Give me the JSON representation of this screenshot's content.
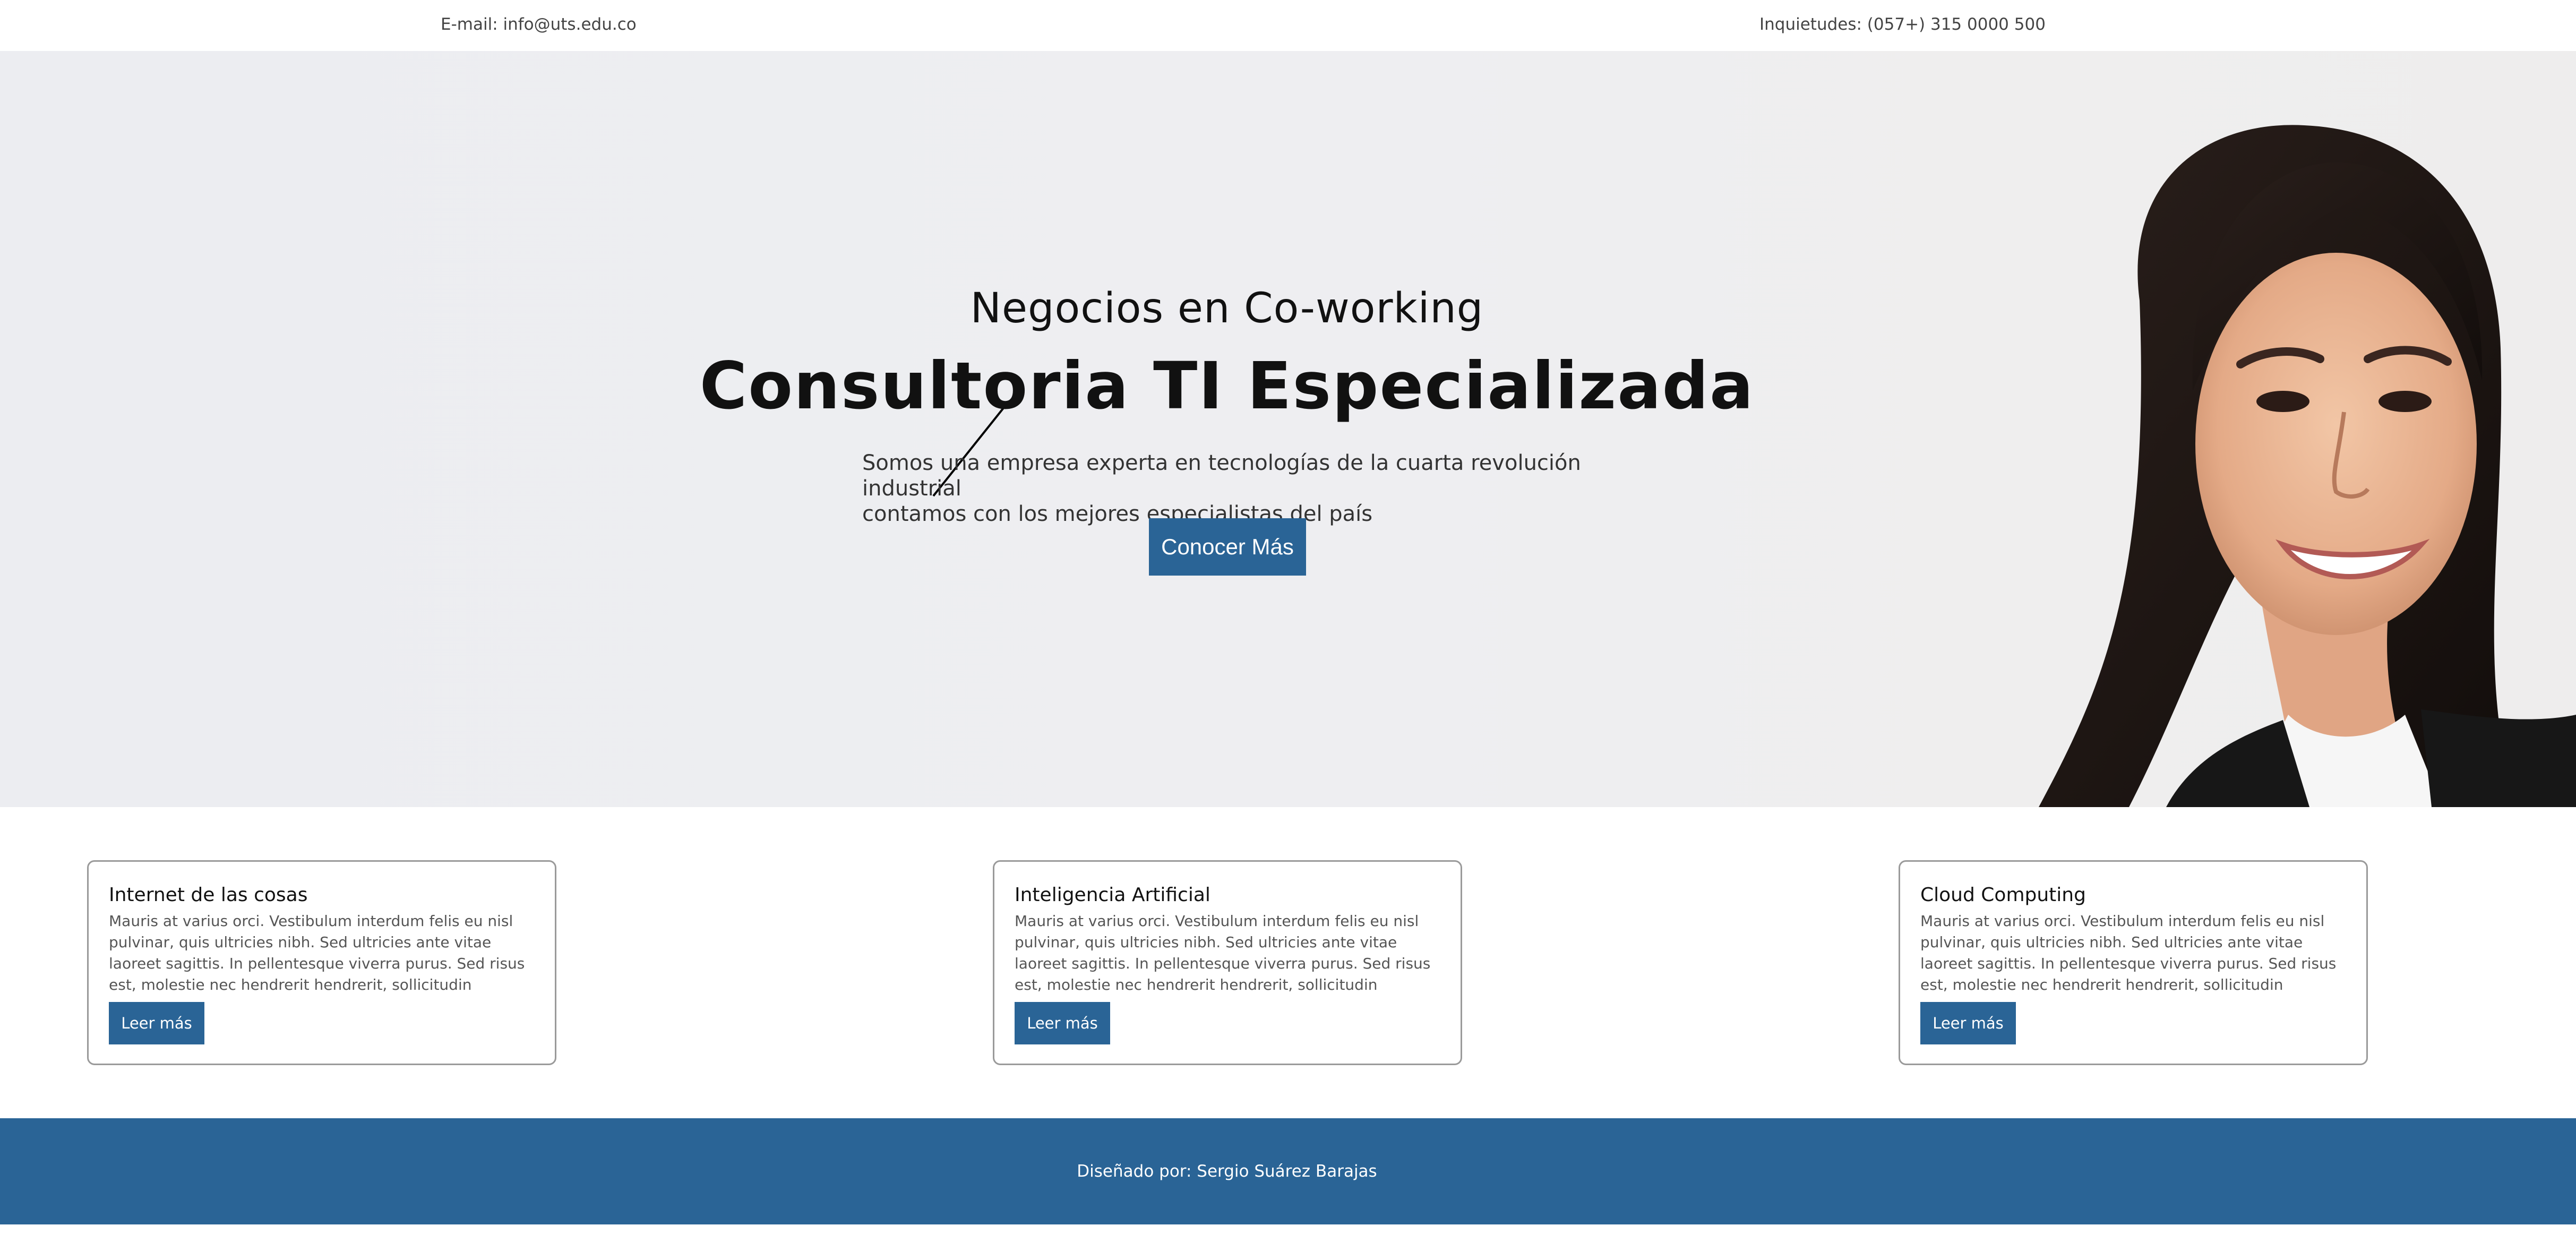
{
  "topbar": {
    "email": "E-mail: info@uts.edu.co",
    "phone": "Inquietudes: (057+) 315 0000 500"
  },
  "hero": {
    "subtitle": "Negocios en Co-working",
    "title": "Consultoria TI Especializada",
    "description_line1": "Somos una empresa experta en tecnologías de la cuarta revolución industrial",
    "description_line2": "contamos con los mejores especialistas del país",
    "cta_label": "Conocer Más"
  },
  "cards": [
    {
      "title": "Internet de las cosas",
      "body": "Mauris at varius orci. Vestibulum interdum felis eu nisl pulvinar, quis ultricies nibh. Sed ultricies ante vitae laoreet sagittis. In pellentesque viverra purus. Sed risus est, molestie nec hendrerit hendrerit, sollicitudin",
      "button_label": "Leer más"
    },
    {
      "title": "Inteligencia Artificial",
      "body": "Mauris at varius orci. Vestibulum interdum felis eu nisl pulvinar, quis ultricies nibh. Sed ultricies ante vitae laoreet sagittis. In pellentesque viverra purus. Sed risus est, molestie nec hendrerit hendrerit, sollicitudin",
      "button_label": "Leer más"
    },
    {
      "title": "Cloud Computing",
      "body": "Mauris at varius orci. Vestibulum interdum felis eu nisl pulvinar, quis ultricies nibh. Sed ultricies ante vitae laoreet sagittis. In pellentesque viverra purus. Sed risus est, molestie nec hendrerit hendrerit, sollicitudin",
      "button_label": "Leer más"
    }
  ],
  "footer": {
    "credit": "Diseñado por: Sergio Suárez Barajas"
  },
  "colors": {
    "accent": "#2a6496",
    "hero_background": "#eeeef1"
  },
  "icons": {
    "hero_image": "smiling-woman-portrait"
  }
}
